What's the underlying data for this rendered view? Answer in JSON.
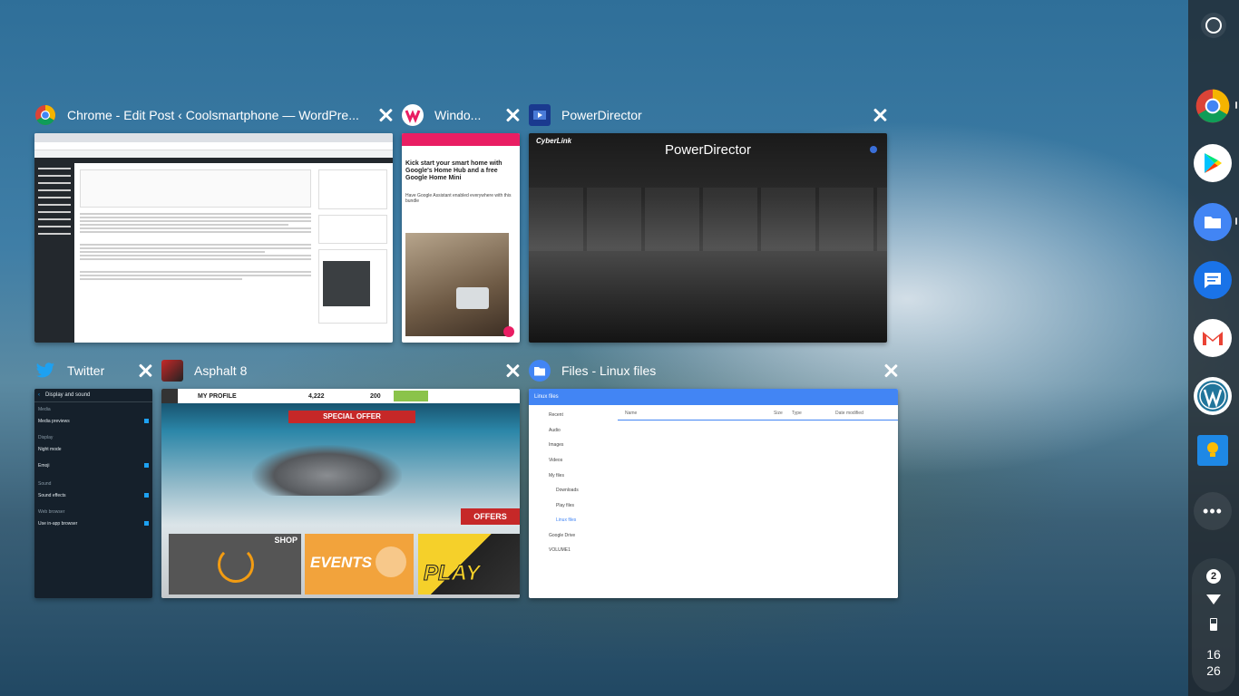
{
  "windows": {
    "chrome": {
      "title": "Chrome - Edit Post ‹ Coolsmartphone — WordPre..."
    },
    "window_app": {
      "title": "Windo...",
      "article_headline": "Kick start your smart home with Google's Home Hub and a free Google Home Mini",
      "article_intro": "Have Google Assistant enabled everywhere with this bundle"
    },
    "powerdirector": {
      "title": "PowerDirector",
      "brand": "CyberLink",
      "app_name": "PowerDirector"
    },
    "twitter": {
      "title": "Twitter",
      "screen_title": "Display and sound",
      "sections": [
        {
          "header": "Media",
          "rows": [
            "Media previews"
          ]
        },
        {
          "header": "Display",
          "rows": [
            "Night mode",
            "Emoji"
          ]
        },
        {
          "header": "Sound",
          "rows": [
            "Sound effects"
          ]
        },
        {
          "header": "Web browser",
          "rows": [
            "Use in-app browser"
          ]
        }
      ]
    },
    "asphalt": {
      "title": "Asphalt 8",
      "my_profile": "MY PROFILE",
      "currency1": "4,222",
      "currency2": "200",
      "special_offer": "SPECIAL OFFER",
      "offers": "OFFERS",
      "shop": "SHOP",
      "events": "EVENTS",
      "play": "PLAY"
    },
    "files": {
      "title": "Files - Linux files",
      "toolbar_title": "Linux files",
      "nav": [
        "Recent",
        "Audio",
        "Images",
        "Videos",
        "My files",
        "Downloads",
        "Play files",
        "Linux files",
        "Google Drive",
        "VOLUME1"
      ],
      "columns": [
        "Name",
        "Size",
        "Type",
        "Date modified"
      ]
    }
  },
  "shelf": {
    "apps": [
      "chrome-icon",
      "play-store-icon",
      "files-icon",
      "messages-icon",
      "gmail-icon",
      "wordpress-icon",
      "keep-icon",
      "more-icon"
    ],
    "notification_count": "2",
    "time_hour": "16",
    "time_minute": "26"
  },
  "colors": {
    "files_blue": "#4285f4",
    "shelf_bg": "#202124"
  }
}
